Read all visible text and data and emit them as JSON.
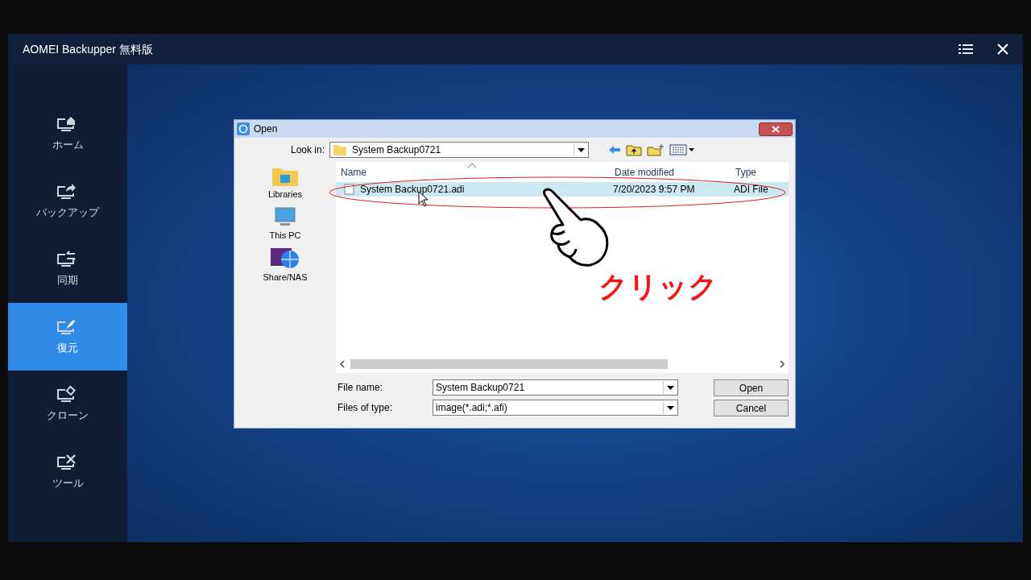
{
  "app": {
    "title": "AOMEI Backupper 無料版"
  },
  "sidebar": {
    "items": [
      {
        "label": "ホーム",
        "kind": "home",
        "selected": false
      },
      {
        "label": "バックアップ",
        "kind": "backup",
        "selected": false
      },
      {
        "label": "同期",
        "kind": "sync",
        "selected": false
      },
      {
        "label": "復元",
        "kind": "restore",
        "selected": true
      },
      {
        "label": "クローン",
        "kind": "clone",
        "selected": false
      },
      {
        "label": "ツール",
        "kind": "tools",
        "selected": false
      }
    ]
  },
  "dialog": {
    "title": "Open",
    "look_in_label": "Look in:",
    "look_in_value": "System Backup0721",
    "places": [
      {
        "label": "Libraries",
        "kind": "libraries"
      },
      {
        "label": "This PC",
        "kind": "pc"
      },
      {
        "label": "Share/NAS",
        "kind": "nas"
      }
    ],
    "columns": [
      "Name",
      "Date modified",
      "Type"
    ],
    "rows": [
      {
        "name": "System Backup0721.adi",
        "date": "7/20/2023 9:57 PM",
        "type": "ADI File",
        "selected": true
      }
    ],
    "file_name_label": "File name:",
    "file_name_value": "System Backup0721",
    "file_type_label": "Files of type:",
    "file_type_value": "image(*.adi;*.afi)",
    "buttons": [
      "Open",
      "Cancel"
    ]
  },
  "annotation": {
    "text": "クリック"
  }
}
